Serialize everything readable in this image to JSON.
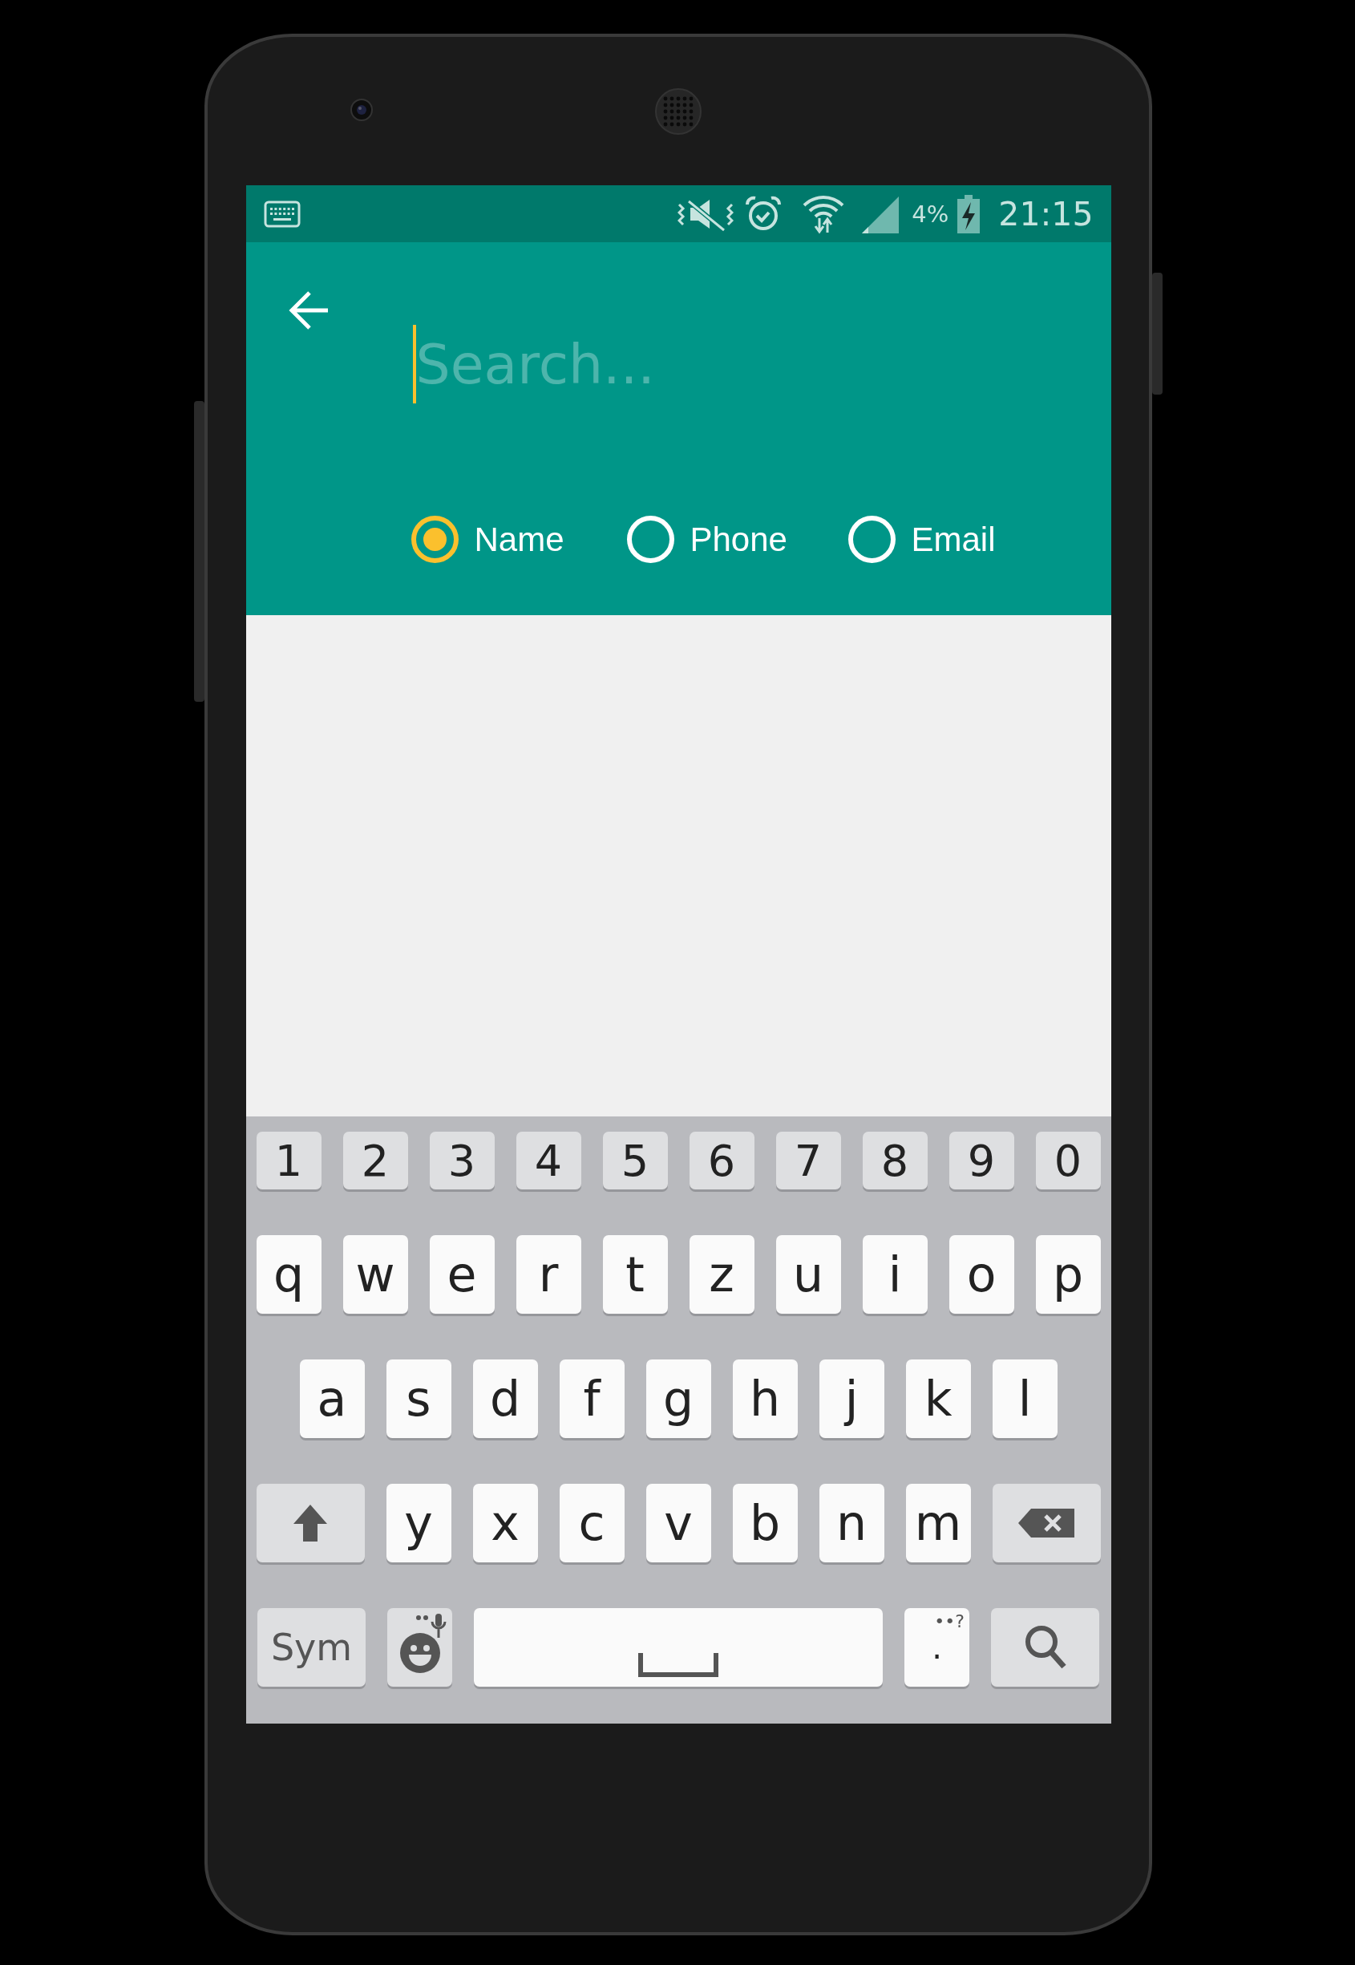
{
  "status_bar": {
    "battery": "4%",
    "time": "21:15"
  },
  "search": {
    "placeholder": "Search..."
  },
  "filter_options": [
    {
      "label": "Name",
      "selected": true
    },
    {
      "label": "Phone",
      "selected": false
    },
    {
      "label": "Email",
      "selected": false
    }
  ],
  "keyboard": {
    "rows": [
      [
        {
          "kind": "number",
          "label": "1"
        },
        {
          "kind": "number",
          "label": "2"
        },
        {
          "kind": "number",
          "label": "3"
        },
        {
          "kind": "number",
          "label": "4"
        },
        {
          "kind": "number",
          "label": "5"
        },
        {
          "kind": "number",
          "label": "6"
        },
        {
          "kind": "number",
          "label": "7"
        },
        {
          "kind": "number",
          "label": "8"
        },
        {
          "kind": "number",
          "label": "9"
        },
        {
          "kind": "number",
          "label": "0"
        }
      ],
      [
        {
          "kind": "letter",
          "label": "q"
        },
        {
          "kind": "letter",
          "label": "w"
        },
        {
          "kind": "letter",
          "label": "e"
        },
        {
          "kind": "letter",
          "label": "r"
        },
        {
          "kind": "letter",
          "label": "t"
        },
        {
          "kind": "letter",
          "label": "z"
        },
        {
          "kind": "letter",
          "label": "u"
        },
        {
          "kind": "letter",
          "label": "i"
        },
        {
          "kind": "letter",
          "label": "o"
        },
        {
          "kind": "letter",
          "label": "p"
        }
      ],
      [
        {
          "kind": "letter",
          "label": "a"
        },
        {
          "kind": "letter",
          "label": "s"
        },
        {
          "kind": "letter",
          "label": "d"
        },
        {
          "kind": "letter",
          "label": "f"
        },
        {
          "kind": "letter",
          "label": "g"
        },
        {
          "kind": "letter",
          "label": "h"
        },
        {
          "kind": "letter",
          "label": "j"
        },
        {
          "kind": "letter",
          "label": "k"
        },
        {
          "kind": "letter",
          "label": "l"
        }
      ],
      [
        {
          "kind": "shift"
        },
        {
          "kind": "letter",
          "label": "y"
        },
        {
          "kind": "letter",
          "label": "x"
        },
        {
          "kind": "letter",
          "label": "c"
        },
        {
          "kind": "letter",
          "label": "v"
        },
        {
          "kind": "letter",
          "label": "b"
        },
        {
          "kind": "letter",
          "label": "n"
        },
        {
          "kind": "letter",
          "label": "m"
        },
        {
          "kind": "delete"
        }
      ],
      [
        {
          "kind": "function",
          "label": "Sym"
        },
        {
          "kind": "emoji"
        },
        {
          "kind": "space"
        },
        {
          "kind": "punctuation",
          "label": ".",
          "hint": "••?"
        },
        {
          "kind": "search"
        }
      ]
    ]
  }
}
